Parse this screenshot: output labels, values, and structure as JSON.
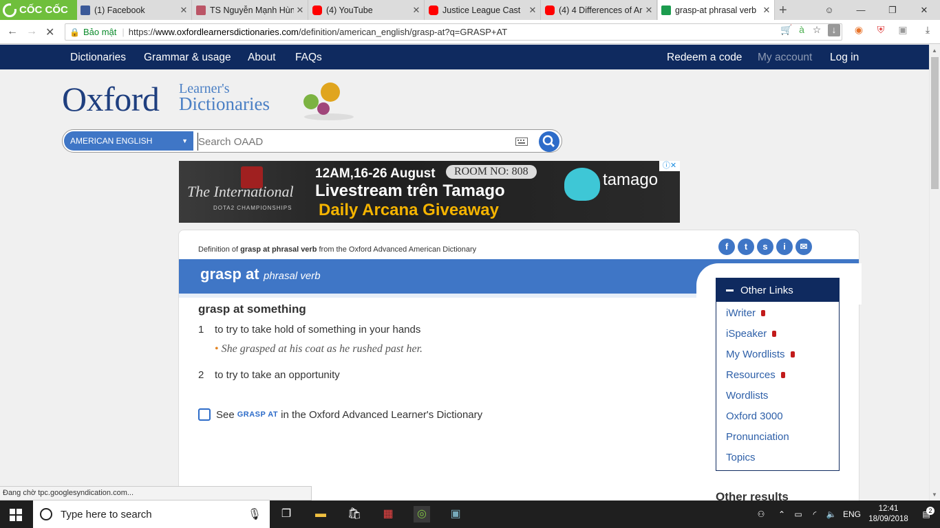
{
  "browser": {
    "logo_text": "CỐC CỐC",
    "tabs": [
      {
        "title": "(1) Facebook",
        "icon": "facebook-icon"
      },
      {
        "title": "TS Nguyễn Mạnh Hùn",
        "icon": "site-icon"
      },
      {
        "title": "(4) YouTube",
        "icon": "youtube-icon"
      },
      {
        "title": "Justice League Cast",
        "icon": "youtube-icon"
      },
      {
        "title": "(4) 4 Differences of Ar",
        "icon": "youtube-icon"
      },
      {
        "title": "grasp-at phrasal verb",
        "icon": "oxford-icon",
        "active": true
      }
    ],
    "security_label": "Bảo mật",
    "url_scheme": "https://",
    "url_host": "www.oxfordlearnersdictionaries.com",
    "url_path": "/definition/american_english/grasp-at?q=GRASP+AT"
  },
  "nav": {
    "left": [
      "Dictionaries",
      "Grammar & usage",
      "About",
      "FAQs"
    ],
    "right": [
      "Redeem a code",
      "My account",
      "Log in"
    ]
  },
  "logo": {
    "oxford": "Oxford",
    "learners": "Learner's",
    "dictionaries": "Dictionaries"
  },
  "search": {
    "dropdown": "AMERICAN ENGLISH",
    "placeholder": "Search OAAD"
  },
  "ad": {
    "line1": "12AM,16-26 August",
    "room": "ROOM NO: 808",
    "line2": "Livestream trên Tamago",
    "line3": "Daily Arcana Giveaway",
    "brand": "tamago",
    "intl": "The International",
    "champ": "DOTA2 CHAMPIONSHIPS"
  },
  "entry": {
    "crumb_prefix": "Definition of",
    "crumb_bold": "grasp at phrasal verb",
    "crumb_suffix": "from the Oxford Advanced American Dictionary",
    "headword": "grasp at",
    "pos": "phrasal verb",
    "phrase": "grasp at something",
    "senses": [
      {
        "num": "1",
        "def": "to try to take hold of something in your hands"
      },
      {
        "num": "2",
        "def": "to try to take an opportunity"
      }
    ],
    "example": "She grasped at his coat as he rushed past her.",
    "see_prefix": "See",
    "see_link": "GRASP AT",
    "see_suffix": "in the Oxford Advanced Learner's Dictionary"
  },
  "other_links": {
    "title": "Other Links",
    "items": [
      "iWriter",
      "iSpeaker",
      "My Wordlists",
      "Resources",
      "Wordlists",
      "Oxford 3000",
      "Pronunciation",
      "Topics"
    ],
    "locked": [
      true,
      true,
      true,
      true,
      false,
      false,
      false,
      false
    ]
  },
  "other_results": "Other results",
  "status": "Đang chờ tpc.googlesyndication.com...",
  "taskbar": {
    "search_placeholder": "Type here to search",
    "lang": "ENG",
    "time": "12:41",
    "date": "18/09/2018",
    "notif": "2"
  },
  "colors": {
    "nav": "#0f2a5f",
    "accent": "#3f76c6",
    "link": "#2d5fa8",
    "ad_yellow": "#f5b400"
  }
}
